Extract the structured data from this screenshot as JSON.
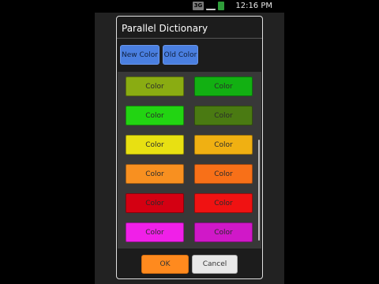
{
  "status_bar": {
    "time": "12:16 PM",
    "network_label": "3G"
  },
  "dialog": {
    "title": "Parallel Dictionary",
    "mode_buttons": {
      "new_label": "New Color",
      "old_label": "Old Color"
    },
    "swatches": [
      {
        "label": "Color",
        "color": "#8aac12"
      },
      {
        "label": "Color",
        "color": "#12b012"
      },
      {
        "label": "Color",
        "color": "#22d412"
      },
      {
        "label": "Color",
        "color": "#4a7a12"
      },
      {
        "label": "Color",
        "color": "#e8e012"
      },
      {
        "label": "Color",
        "color": "#f0b012"
      },
      {
        "label": "Color",
        "color": "#f89020"
      },
      {
        "label": "Color",
        "color": "#f87018"
      },
      {
        "label": "Color",
        "color": "#d40012"
      },
      {
        "label": "Color",
        "color": "#f01212"
      },
      {
        "label": "Color",
        "color": "#f020e8"
      },
      {
        "label": "Color",
        "color": "#d018c8"
      }
    ],
    "ok_label": "OK",
    "cancel_label": "Cancel"
  }
}
